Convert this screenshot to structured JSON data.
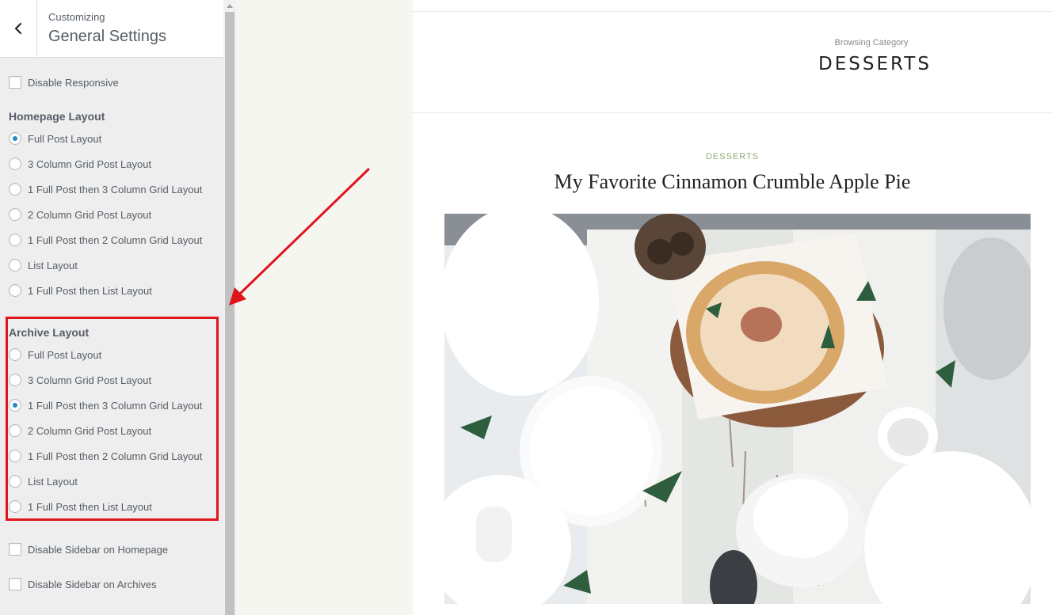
{
  "sidebar": {
    "back_icon": "chevron-left-icon",
    "subtitle": "Customizing",
    "title": "General Settings",
    "disable_responsive": "Disable Responsive",
    "homepage_heading": "Homepage Layout",
    "homepage_options": [
      "Full Post Layout",
      "3 Column Grid Post Layout",
      "1 Full Post then 3 Column Grid Layout",
      "2 Column Grid Post Layout",
      "1 Full Post then 2 Column Grid Layout",
      "List Layout",
      "1 Full Post then List Layout"
    ],
    "homepage_selected": "Full Post Layout",
    "archive_heading": "Archive Layout",
    "archive_options": [
      "Full Post Layout",
      "3 Column Grid Post Layout",
      "1 Full Post then 3 Column Grid Layout",
      "2 Column Grid Post Layout",
      "1 Full Post then 2 Column Grid Layout",
      "List Layout",
      "1 Full Post then List Layout"
    ],
    "archive_selected": "1 Full Post then 3 Column Grid Layout",
    "disable_sidebar_home": "Disable Sidebar on Homepage",
    "disable_sidebar_archives": "Disable Sidebar on Archives"
  },
  "preview": {
    "browsing_label": "Browsing Category",
    "category_title": "DESSERTS",
    "post_category": "DESSERTS",
    "post_title": "My Favorite Cinnamon Crumble Apple Pie"
  },
  "colors": {
    "highlight": "#e0141b",
    "radio_accent": "#1e8cbe",
    "post_category": "#8fac74"
  }
}
